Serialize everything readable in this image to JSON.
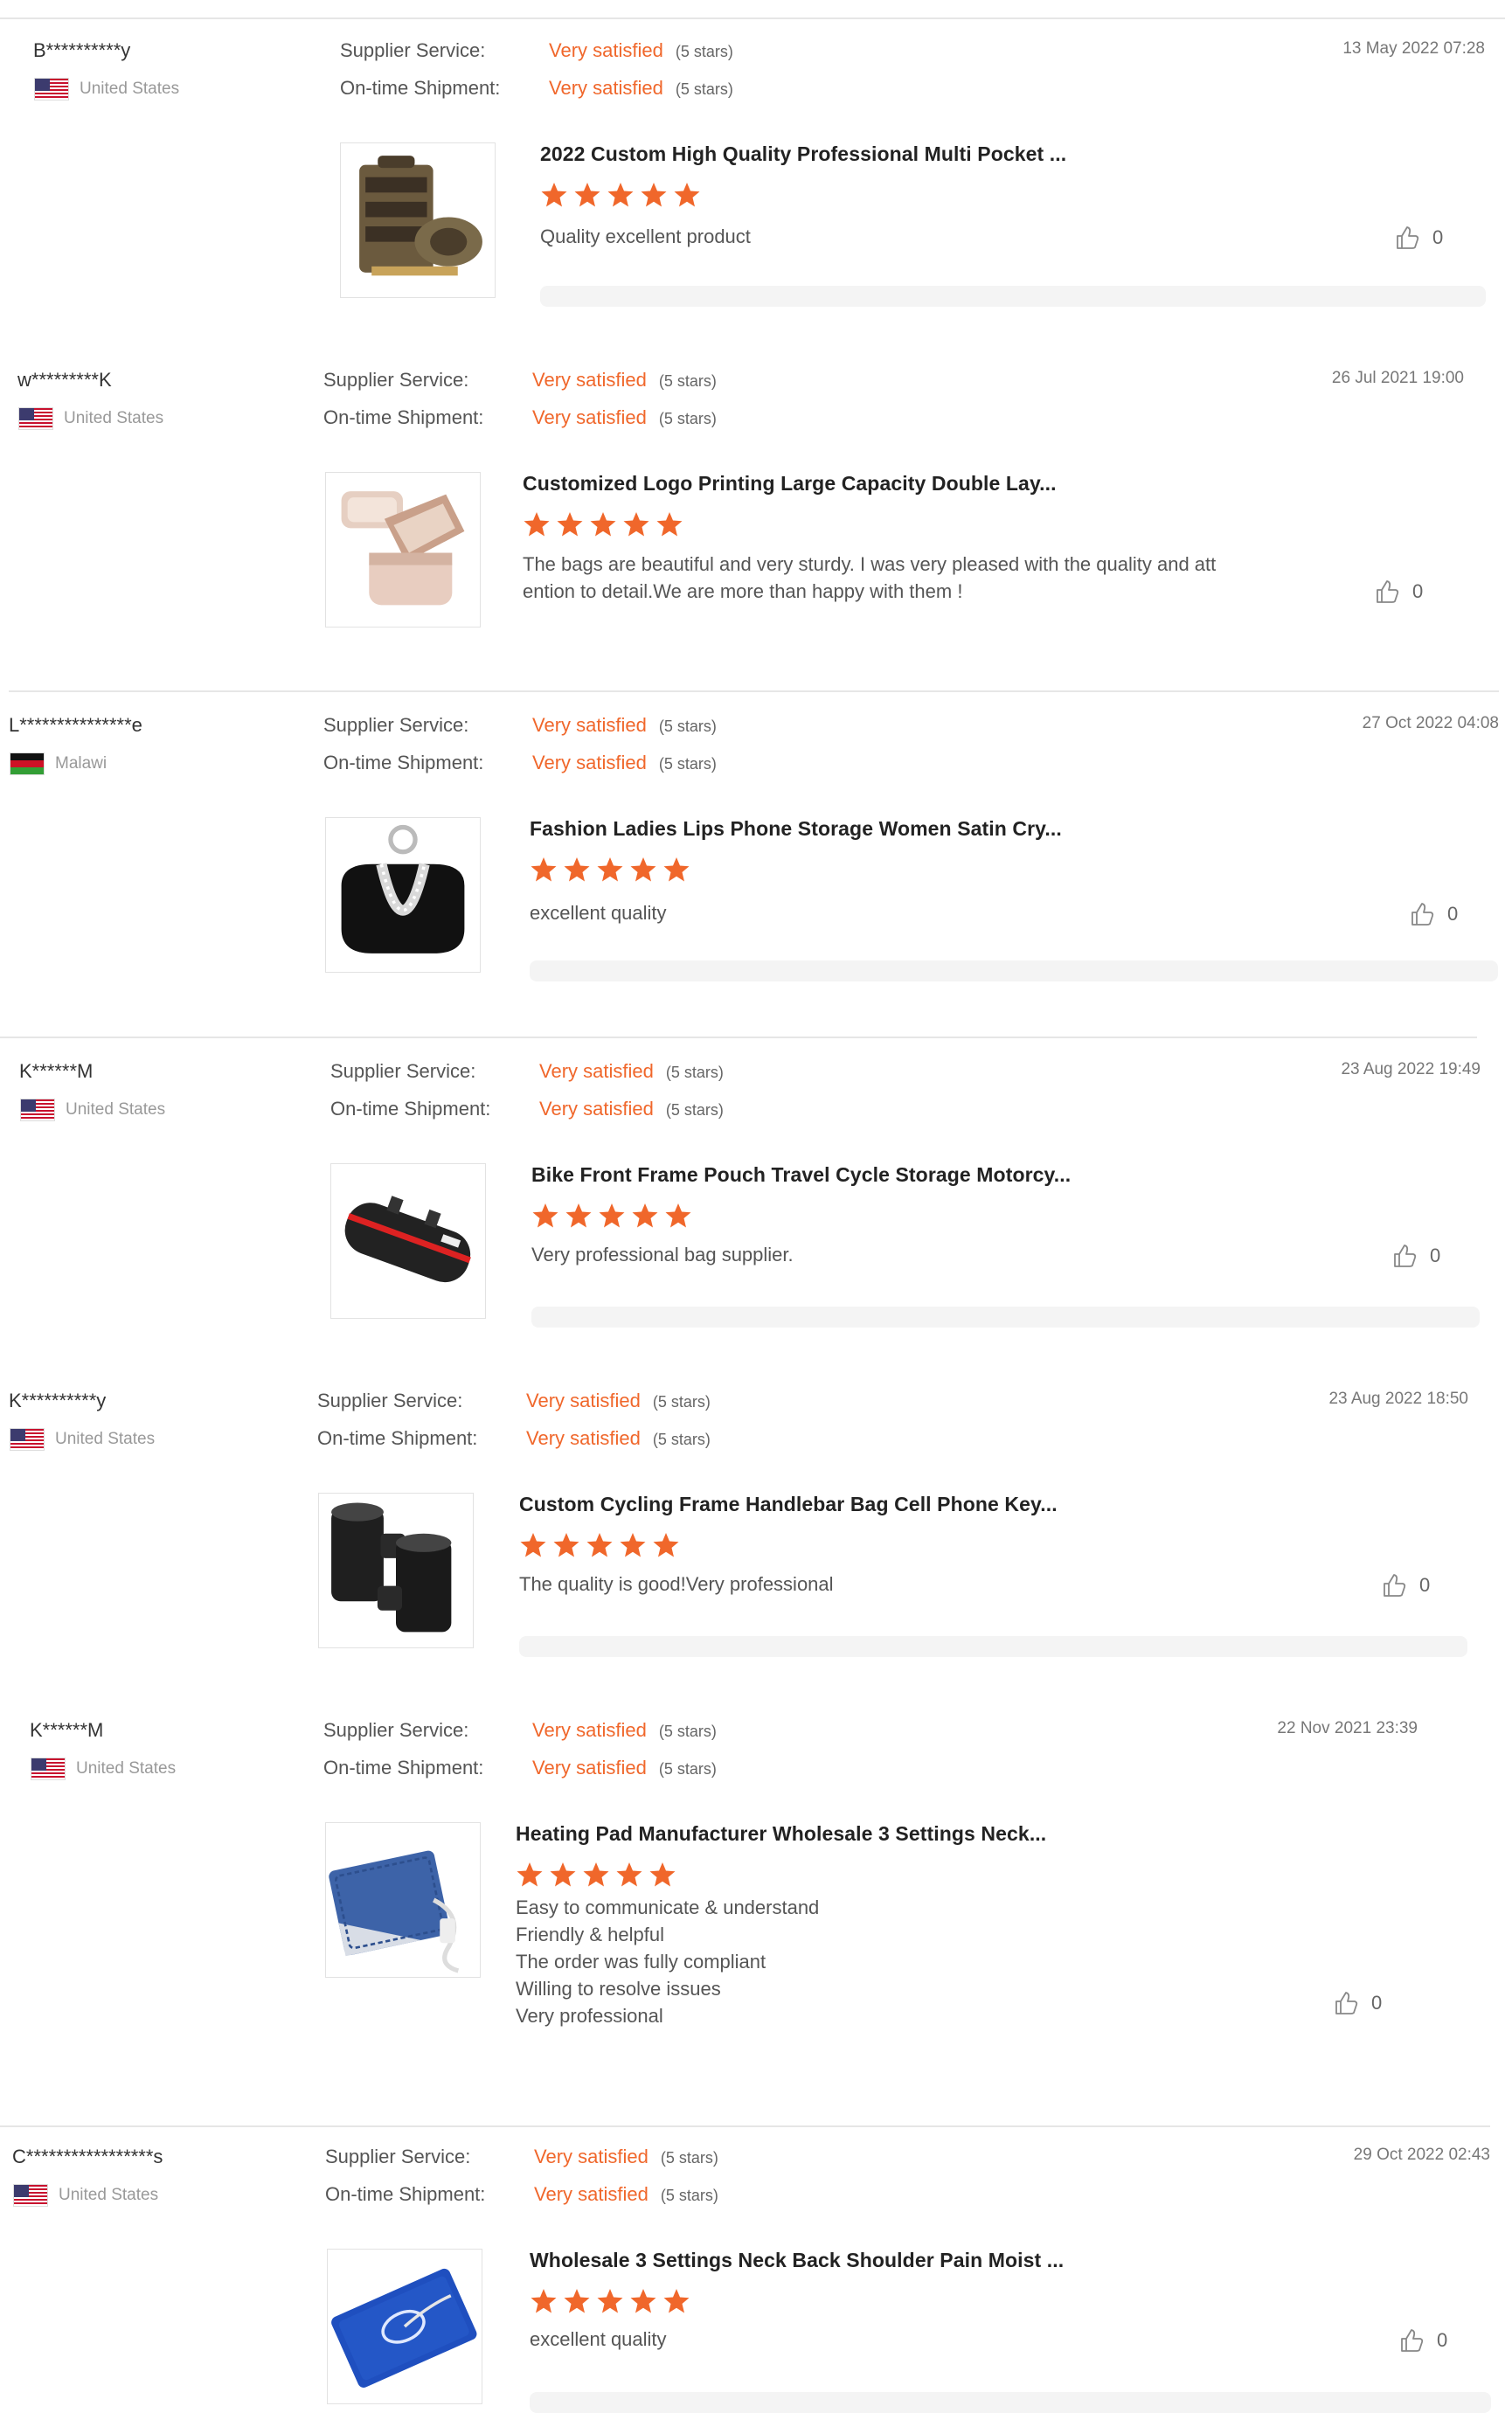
{
  "labels": {
    "supplier_service": "Supplier Service:",
    "ontime_shipment": "On-time Shipment:"
  },
  "colors": {
    "accent": "#f0672b",
    "separator": "#e6e6e6"
  },
  "reviews": [
    {
      "user": "B**********y",
      "country": "United States",
      "flag": "us",
      "supplier_value": "Very satisfied",
      "supplier_stars": "(5 stars)",
      "shipment_value": "Very satisfied",
      "shipment_stars": "(5 stars)",
      "date": "13 May 2022 07:28",
      "product": "2022 Custom High Quality Professional Multi Pocket ...",
      "rating": 5,
      "comment": "Quality excellent product",
      "likes": "0",
      "image_icon": "tool-roll-bag-image"
    },
    {
      "user": "w*********K",
      "country": "United States",
      "flag": "us",
      "supplier_value": "Very satisfied",
      "supplier_stars": "(5 stars)",
      "shipment_value": "Very satisfied",
      "shipment_stars": "(5 stars)",
      "date": "26 Jul 2021 19:00",
      "product": "Customized Logo Printing Large Capacity Double Lay...",
      "rating": 5,
      "comment": "The bags are beautiful and very sturdy. I was very pleased with the quality and att\nention to detail.We are more than happy with them !",
      "likes": "0",
      "image_icon": "cosmetic-bag-image"
    },
    {
      "user": "L***************e",
      "country": "Malawi",
      "flag": "mw",
      "supplier_value": "Very satisfied",
      "supplier_stars": "(5 stars)",
      "shipment_value": "Very satisfied",
      "shipment_stars": "(5 stars)",
      "date": "27 Oct 2022 04:08",
      "product": "Fashion Ladies Lips Phone Storage Women Satin Cry...",
      "rating": 5,
      "comment": "excellent quality",
      "likes": "0",
      "image_icon": "clutch-bag-image"
    },
    {
      "user": "K******M",
      "country": "United States",
      "flag": "us",
      "supplier_value": "Very satisfied",
      "supplier_stars": "(5 stars)",
      "shipment_value": "Very satisfied",
      "shipment_stars": "(5 stars)",
      "date": "23 Aug 2022 19:49",
      "product": "Bike Front Frame Pouch Travel Cycle Storage Motorcy...",
      "rating": 5,
      "comment": "Very professional bag supplier.",
      "likes": "0",
      "image_icon": "bike-pouch-image"
    },
    {
      "user": "K**********y",
      "country": "United States",
      "flag": "us",
      "supplier_value": "Very satisfied",
      "supplier_stars": "(5 stars)",
      "shipment_value": "Very satisfied",
      "shipment_stars": "(5 stars)",
      "date": "23 Aug 2022 18:50",
      "product": "Custom Cycling Frame Handlebar Bag Cell Phone Key...",
      "rating": 5,
      "comment": "The quality is good!Very professional",
      "likes": "0",
      "image_icon": "bottle-holder-image"
    },
    {
      "user": "K******M",
      "country": "United States",
      "flag": "us",
      "supplier_value": "Very satisfied",
      "supplier_stars": "(5 stars)",
      "shipment_value": "Very satisfied",
      "shipment_stars": "(5 stars)",
      "date": "22 Nov 2021 23:39",
      "product": "Heating Pad Manufacturer Wholesale 3 Settings Neck...",
      "rating": 5,
      "comment": "Easy to communicate & understand\nFriendly & helpful\nThe order was fully compliant\nWilling to resolve issues\nVery professional",
      "likes": "0",
      "image_icon": "heating-pad-image"
    },
    {
      "user": "C*****************s",
      "country": "United States",
      "flag": "us",
      "supplier_value": "Very satisfied",
      "supplier_stars": "(5 stars)",
      "shipment_value": "Very satisfied",
      "shipment_stars": "(5 stars)",
      "date": "29 Oct 2022 02:43",
      "product": "Wholesale 3 Settings Neck Back Shoulder Pain Moist ...",
      "rating": 5,
      "comment": "excellent quality",
      "likes": "0",
      "image_icon": "heating-pad-blue-image"
    }
  ]
}
